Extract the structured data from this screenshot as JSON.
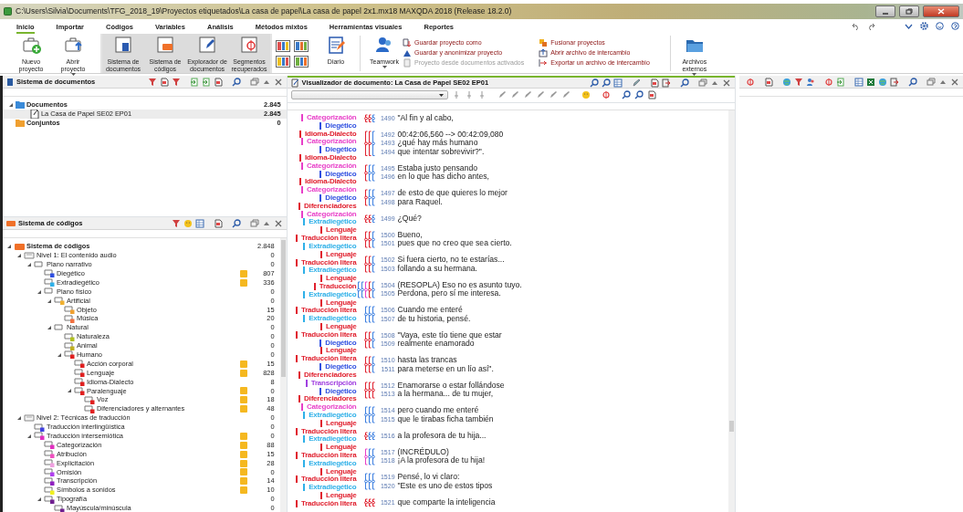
{
  "window": {
    "title": "C:\\Users\\Silvia\\Documents\\TFG_2018_19\\Proyectos etiquetados\\La casa de papel\\La casa de papel 2x1.mx18   MAXQDA 2018 (Release 18.2.0)"
  },
  "ribbon": {
    "tabs": [
      {
        "label": "Inicio",
        "selected": true
      },
      {
        "label": "Importar",
        "selected": false
      },
      {
        "label": "Códigos",
        "selected": false
      },
      {
        "label": "Variables",
        "selected": false
      },
      {
        "label": "Análisis",
        "selected": false
      },
      {
        "label": "Métodos mixtos",
        "selected": false
      },
      {
        "label": "Herramientas visuales",
        "selected": false
      },
      {
        "label": "Reportes",
        "selected": false
      }
    ],
    "project_buttons": [
      {
        "label": "Nuevo proyecto",
        "dropdown": false
      },
      {
        "label": "Abrir proyecto",
        "dropdown": true
      }
    ],
    "pane_buttons": [
      {
        "label": "Sistema de documentos",
        "active": true
      },
      {
        "label": "Sistema de códigos",
        "active": true
      },
      {
        "label": "Explorador de documentos",
        "active": true
      },
      {
        "label": "Segmentos recuperados",
        "active": true
      }
    ],
    "tool_buttons": [
      {
        "label": "Diario",
        "dropdown": false
      },
      {
        "label": "Teamwork",
        "dropdown": true
      }
    ],
    "commands": [
      {
        "label": "Guardar proyecto como",
        "disabled": false
      },
      {
        "label": "Guardar y anonimizar proyecto",
        "disabled": false
      },
      {
        "label": "Proyecto desde documentos activados",
        "disabled": true
      },
      {
        "label": "Fusionar proyectos",
        "disabled": false
      },
      {
        "label": "Abrir archivo de intercambio",
        "disabled": false
      },
      {
        "label": "Exportar un archivo de intercambio",
        "disabled": false
      }
    ],
    "external_button": {
      "label": "Archivos externos",
      "dropdown": true
    }
  },
  "document_system": {
    "title": "Sistema de documentos",
    "items": [
      {
        "kind": "folder",
        "label": "Documentos",
        "count": "2.845",
        "selected": false,
        "expanded": true,
        "children": [
          {
            "kind": "document",
            "label": "La Casa de Papel SE02 EP01",
            "count": "2.845",
            "selected": true
          }
        ]
      },
      {
        "kind": "sets",
        "label": "Conjuntos",
        "count": "0",
        "selected": false
      }
    ]
  },
  "code_system": {
    "title": "Sistema de códigos",
    "items": [
      {
        "kind": "root",
        "label": "Sistema de códigos",
        "count": "2.848",
        "memo": false,
        "expanded": true,
        "children": [
          {
            "kind": "category",
            "label": "Nivel 1: El contenido audio",
            "count": "0",
            "memo": false,
            "expanded": true,
            "children": [
              {
                "kind": "code",
                "label": "Plano narrativo",
                "count": "0",
                "memo": false,
                "expanded": true,
                "children": [
                  {
                    "kind": "code",
                    "label": "Diegético",
                    "color": "#2f4fe0",
                    "count": "807",
                    "memo": true
                  },
                  {
                    "kind": "code",
                    "label": "Extradiegético",
                    "color": "#2fb0e8",
                    "count": "336",
                    "memo": true
                  },
                  {
                    "kind": "code",
                    "label": "Plano físico",
                    "count": "0",
                    "memo": false,
                    "expanded": true,
                    "children": [
                      {
                        "kind": "code",
                        "label": "Artificial",
                        "color": "#f0b030",
                        "count": "0",
                        "memo": false,
                        "expanded": true,
                        "children": [
                          {
                            "kind": "code",
                            "label": "Objeto",
                            "color": "#f0a030",
                            "count": "15",
                            "memo": false
                          },
                          {
                            "kind": "code",
                            "label": "Música",
                            "color": "#f07040",
                            "count": "20",
                            "memo": false
                          }
                        ]
                      },
                      {
                        "kind": "code",
                        "label": "Natural",
                        "count": "0",
                        "memo": false,
                        "expanded": true,
                        "children": [
                          {
                            "kind": "code",
                            "label": "Naturaleza",
                            "color": "#b0c020",
                            "count": "0",
                            "memo": false
                          },
                          {
                            "kind": "code",
                            "label": "Animal",
                            "color": "#c0b020",
                            "count": "0",
                            "memo": false
                          },
                          {
                            "kind": "code",
                            "label": "Humano",
                            "color": "#e02020",
                            "count": "0",
                            "memo": false,
                            "expanded": true,
                            "children": [
                              {
                                "kind": "code",
                                "label": "Acción corporal",
                                "color": "#e02020",
                                "count": "15",
                                "memo": true
                              },
                              {
                                "kind": "code",
                                "label": "Lenguaje",
                                "color": "#e02020",
                                "count": "828",
                                "memo": true
                              },
                              {
                                "kind": "code",
                                "label": "Idioma-Dialecto",
                                "color": "#e02020",
                                "count": "8",
                                "memo": false
                              },
                              {
                                "kind": "code",
                                "label": "Paralenguaje",
                                "color": "#e02020",
                                "count": "0",
                                "memo": true,
                                "expanded": true,
                                "children": [
                                  {
                                    "kind": "code",
                                    "label": "Voz",
                                    "color": "#e02020",
                                    "count": "18",
                                    "memo": true
                                  },
                                  {
                                    "kind": "code",
                                    "label": "Diferenciadores y alternantes",
                                    "color": "#e02020",
                                    "count": "48",
                                    "memo": true
                                  }
                                ]
                              }
                            ]
                          }
                        ]
                      }
                    ]
                  }
                ]
              }
            ]
          },
          {
            "kind": "category",
            "label": "Nivel 2: Técnicas de traducción",
            "count": "0",
            "memo": false,
            "expanded": true,
            "children": [
              {
                "kind": "code",
                "label": "Traducción interlingüística",
                "color": "#4040e0",
                "count": "0",
                "memo": false
              },
              {
                "kind": "code",
                "label": "Traducción intersemiótica",
                "color": "#e030c0",
                "count": "0",
                "memo": true,
                "expanded": true,
                "children": [
                  {
                    "kind": "code",
                    "label": "Categorización",
                    "color": "#e030c0",
                    "count": "88",
                    "memo": true
                  },
                  {
                    "kind": "code",
                    "label": "Atribución",
                    "color": "#f050c0",
                    "count": "15",
                    "memo": true
                  },
                  {
                    "kind": "code",
                    "label": "Explicitación",
                    "color": "#f0a0e0",
                    "count": "28",
                    "memo": true
                  },
                  {
                    "kind": "code",
                    "label": "Omisión",
                    "color": "#b040f0",
                    "count": "0",
                    "memo": true
                  },
                  {
                    "kind": "code",
                    "label": "Transcripción",
                    "color": "#9020c0",
                    "count": "14",
                    "memo": true
                  },
                  {
                    "kind": "code",
                    "label": "Símbolos a sonidos",
                    "color": "#f0f020",
                    "count": "10",
                    "memo": true
                  },
                  {
                    "kind": "code",
                    "label": "Tipografía",
                    "color": "#702090",
                    "count": "0",
                    "memo": false,
                    "expanded": true,
                    "children": [
                      {
                        "kind": "code",
                        "label": "Mayúscula/minúscula",
                        "color": "#702090",
                        "count": "0",
                        "memo": false
                      }
                    ]
                  }
                ]
              }
            ]
          }
        ]
      }
    ]
  },
  "viewer": {
    "title": "Visualizador de documento: La Casa de Papel SE02 EP01",
    "margin_codes": [
      {
        "name": "Categorización",
        "color": "#e83fc8"
      },
      {
        "name": "Diegético",
        "color": "#2f4fe0"
      },
      {
        "name": "Idioma-Dialecto",
        "color": "#e0202e"
      },
      {
        "name": "Categorización",
        "color": "#e83fc8"
      },
      {
        "name": "Diegético",
        "color": "#2f4fe0"
      },
      {
        "name": "Idioma-Dialecto",
        "color": "#e0202e"
      },
      {
        "name": "Categorización",
        "color": "#e83fc8"
      },
      {
        "name": "Diegético",
        "color": "#2f4fe0"
      },
      {
        "name": "Idioma-Dialecto",
        "color": "#e0202e"
      },
      {
        "name": "Categorización",
        "color": "#e83fc8"
      },
      {
        "name": "Diegético",
        "color": "#2f4fe0"
      },
      {
        "name": "Diferenciadores",
        "color": "#e0202e"
      },
      {
        "name": "Categorización",
        "color": "#e83fc8"
      },
      {
        "name": "Extradiegético",
        "color": "#2fb0e8"
      },
      {
        "name": "Lenguaje",
        "color": "#e0202e"
      },
      {
        "name": "Traducción litera",
        "color": "#e0202e"
      },
      {
        "name": "Extradiegético",
        "color": "#2fb0e8"
      },
      {
        "name": "Lenguaje",
        "color": "#e0202e"
      },
      {
        "name": "Traducción litera",
        "color": "#e0202e"
      },
      {
        "name": "Extradiegético",
        "color": "#2fb0e8"
      },
      {
        "name": "Lenguaje",
        "color": "#e0202e"
      },
      {
        "name": "Traducción",
        "color": "#e0202e"
      },
      {
        "name": "Extradiegético",
        "color": "#2fb0e8"
      },
      {
        "name": "Lenguaje",
        "color": "#e0202e"
      },
      {
        "name": "Traducción litera",
        "color": "#e0202e"
      },
      {
        "name": "Extradiegético",
        "color": "#2fb0e8"
      },
      {
        "name": "Lenguaje",
        "color": "#e0202e"
      },
      {
        "name": "Traducción litera",
        "color": "#e0202e"
      },
      {
        "name": "Diegético",
        "color": "#2f4fe0"
      },
      {
        "name": "Lenguaje",
        "color": "#e0202e"
      },
      {
        "name": "Traducción litera",
        "color": "#e0202e"
      },
      {
        "name": "Diegético",
        "color": "#2f4fe0"
      },
      {
        "name": "Diferenciadores",
        "color": "#e0202e"
      },
      {
        "name": "Transcripción",
        "color": "#a040e0"
      },
      {
        "name": "Diegético",
        "color": "#2f4fe0"
      },
      {
        "name": "Diferenciadores",
        "color": "#e0202e"
      },
      {
        "name": "Categorización",
        "color": "#e83fc8"
      },
      {
        "name": "Extradiegético",
        "color": "#2fb0e8"
      },
      {
        "name": "Lenguaje",
        "color": "#e0202e"
      },
      {
        "name": "Traducción litera",
        "color": "#e0202e"
      },
      {
        "name": "Extradiegético",
        "color": "#2fb0e8"
      },
      {
        "name": "Lenguaje",
        "color": "#e0202e"
      },
      {
        "name": "Traducción litera",
        "color": "#e0202e"
      },
      {
        "name": "Extradiegético",
        "color": "#2fb0e8"
      },
      {
        "name": "Lenguaje",
        "color": "#e0202e"
      },
      {
        "name": "Traducción litera",
        "color": "#e0202e"
      },
      {
        "name": "Extradiegético",
        "color": "#2fb0e8"
      },
      {
        "name": "Lenguaje",
        "color": "#e0202e"
      },
      {
        "name": "Traducción litera",
        "color": "#e0202e"
      }
    ],
    "blocks": [
      {
        "brackets": [
          {
            "color": "#e0202e"
          },
          {
            "color": "#e0202e"
          },
          {
            "color": "#3c7fe0"
          }
        ],
        "lines": [
          {
            "number": "1490",
            "text": "\"Al fin y al cabo,"
          }
        ]
      },
      {
        "brackets": [
          {
            "color": "#e0202e"
          },
          {
            "color": "#e0202e"
          },
          {
            "color": "#3c7fe0"
          }
        ],
        "lines": [
          {
            "number": "1492",
            "text": "00:42:06,560 --> 00:42:09,080"
          },
          {
            "number": "1493",
            "text": "¿qué hay más humano"
          },
          {
            "number": "1494",
            "text": "que intentar sobrevivir?\"."
          }
        ]
      },
      {
        "brackets": [
          {
            "color": "#e0202e"
          },
          {
            "color": "#3c7fe0"
          },
          {
            "color": "#3c7fe0"
          }
        ],
        "lines": [
          {
            "number": "1495",
            "text": "Estaba justo pensando"
          },
          {
            "number": "1496",
            "text": "en lo que has dicho antes,"
          }
        ]
      },
      {
        "brackets": [
          {
            "color": "#e0202e"
          },
          {
            "color": "#3c7fe0"
          },
          {
            "color": "#3c7fe0"
          }
        ],
        "lines": [
          {
            "number": "1497",
            "text": "de esto de que quieres lo mejor"
          },
          {
            "number": "1498",
            "text": "para Raquel."
          }
        ]
      },
      {
        "brackets": [
          {
            "color": "#e0202e"
          },
          {
            "color": "#e0202e"
          },
          {
            "color": "#3c7fe0"
          }
        ],
        "lines": [
          {
            "number": "1499",
            "text": "¿Qué?"
          }
        ]
      },
      {
        "brackets": [
          {
            "color": "#e0202e"
          },
          {
            "color": "#e0202e"
          },
          {
            "color": "#3c7fe0"
          }
        ],
        "lines": [
          {
            "number": "1500",
            "text": "Bueno,"
          },
          {
            "number": "1501",
            "text": "pues que no creo que sea cierto."
          }
        ]
      },
      {
        "brackets": [
          {
            "color": "#e0202e"
          },
          {
            "color": "#e0202e"
          },
          {
            "color": "#3c7fe0"
          }
        ],
        "lines": [
          {
            "number": "1502",
            "text": "Si fuera cierto, no te estarías..."
          },
          {
            "number": "1503",
            "text": "follando a su hermana."
          }
        ]
      },
      {
        "brackets": [
          {
            "color": "#3c7fe0"
          },
          {
            "color": "#3c7fe0"
          },
          {
            "color": "#e83fc8"
          },
          {
            "color": "#e0202e"
          },
          {
            "color": "#3c7fe0"
          }
        ],
        "lines": [
          {
            "number": "1504",
            "text": "(RESOPLA) Eso no es asunto tuyo."
          },
          {
            "number": "1505",
            "text": "Perdona, pero sí me interesa."
          }
        ]
      },
      {
        "brackets": [
          {
            "color": "#3c7fe0"
          },
          {
            "color": "#3c7fe0"
          },
          {
            "color": "#3c7fe0"
          }
        ],
        "lines": [
          {
            "number": "1506",
            "text": "Cuando me enteré"
          },
          {
            "number": "1507",
            "text": "de tu historia, pensé."
          }
        ]
      },
      {
        "brackets": [
          {
            "color": "#e0202e"
          },
          {
            "color": "#e0202e"
          },
          {
            "color": "#3c7fe0"
          }
        ],
        "lines": [
          {
            "number": "1508",
            "text": "\"Vaya, este tío tiene que estar"
          },
          {
            "number": "1509",
            "text": "realmente enamorado"
          }
        ]
      },
      {
        "brackets": [
          {
            "color": "#e0202e"
          },
          {
            "color": "#e0202e"
          },
          {
            "color": "#3c7fe0"
          }
        ],
        "lines": [
          {
            "number": "1510",
            "text": "hasta las trancas"
          },
          {
            "number": "1511",
            "text": "para meterse en un lío así\"."
          }
        ]
      },
      {
        "brackets": [
          {
            "color": "#e0202e"
          },
          {
            "color": "#e0202e"
          },
          {
            "color": "#e0202e"
          }
        ],
        "lines": [
          {
            "number": "1512",
            "text": "Enamorarse o estar follándose"
          },
          {
            "number": "1513",
            "text": "a la hermana... de tu mujer,"
          }
        ]
      },
      {
        "brackets": [
          {
            "color": "#3c7fe0"
          },
          {
            "color": "#3c7fe0"
          },
          {
            "color": "#3c7fe0"
          }
        ],
        "lines": [
          {
            "number": "1514",
            "text": "pero cuando me enteré"
          },
          {
            "number": "1515",
            "text": "que le tirabas ficha también"
          }
        ]
      },
      {
        "brackets": [
          {
            "color": "#e0202e"
          },
          {
            "color": "#3c7fe0"
          },
          {
            "color": "#3c7fe0"
          }
        ],
        "lines": [
          {
            "number": "1516",
            "text": "a la profesora de tu hija..."
          }
        ]
      },
      {
        "brackets": [
          {
            "color": "#e83fc8"
          },
          {
            "color": "#3c7fe0"
          },
          {
            "color": "#3c7fe0"
          }
        ],
        "lines": [
          {
            "number": "1517",
            "text": "(INCRÉDULO)"
          },
          {
            "number": "1518",
            "text": "¡A la profesora de tu hija!"
          }
        ]
      },
      {
        "brackets": [
          {
            "color": "#3c7fe0"
          },
          {
            "color": "#3c7fe0"
          },
          {
            "color": "#3c7fe0"
          }
        ],
        "lines": [
          {
            "number": "1519",
            "text": "Pensé, lo vi claro:"
          },
          {
            "number": "1520",
            "text": "\"Este es uno de estos tipos"
          }
        ]
      },
      {
        "brackets": [
          {
            "color": "#e0202e"
          },
          {
            "color": "#e0202e"
          },
          {
            "color": "#e0202e"
          }
        ],
        "lines": [
          {
            "number": "1521",
            "text": "que comparte la inteligencia"
          }
        ]
      }
    ]
  }
}
